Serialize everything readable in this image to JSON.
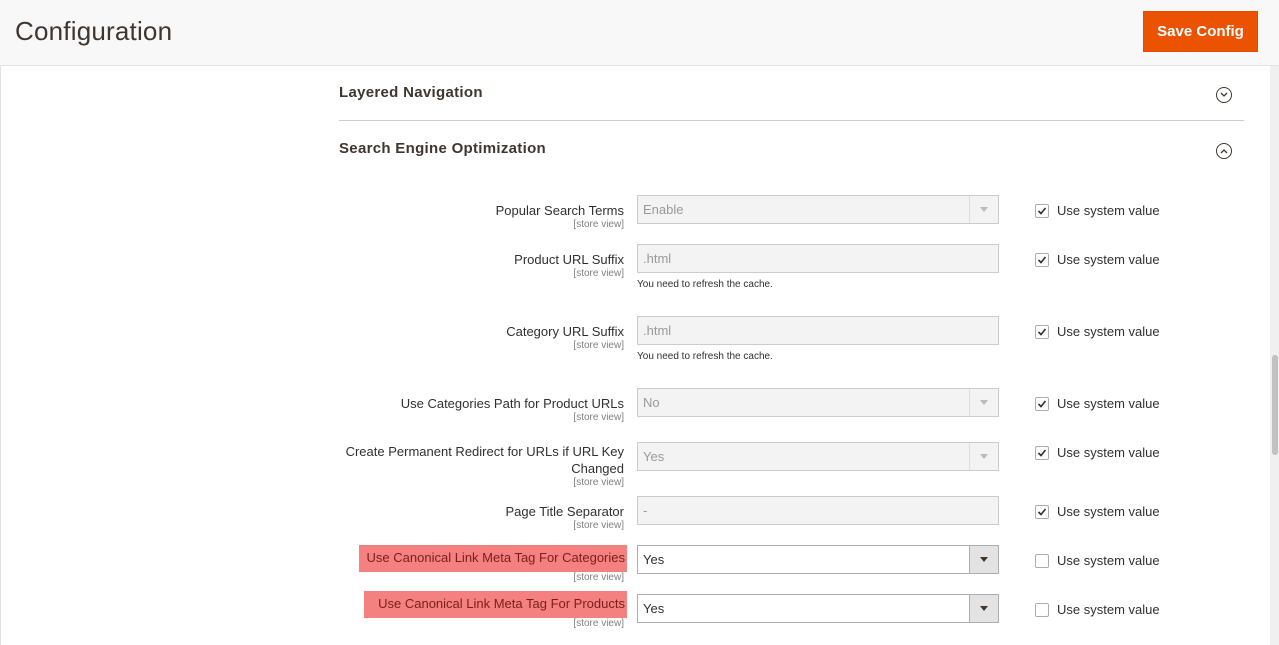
{
  "header": {
    "title": "Configuration",
    "save_label": "Save Config"
  },
  "sections": {
    "layered_navigation": {
      "title": "Layered Navigation",
      "expanded": false
    },
    "seo": {
      "title": "Search Engine Optimization",
      "expanded": true
    }
  },
  "fields": [
    {
      "label": "Popular Search Terms",
      "scope": "[store view]",
      "type": "select",
      "value": "Enable",
      "note": "",
      "use_system_value": true
    },
    {
      "label": "Product URL Suffix",
      "scope": "[store view]",
      "type": "text",
      "value": ".html",
      "note": "You need to refresh the cache.",
      "use_system_value": true
    },
    {
      "label": "Category URL Suffix",
      "scope": "[store view]",
      "type": "text",
      "value": ".html",
      "note": "You need to refresh the cache.",
      "use_system_value": true
    },
    {
      "label": "Use Categories Path for Product URLs",
      "scope": "[store view]",
      "type": "select",
      "value": "No",
      "note": "",
      "use_system_value": true
    },
    {
      "label_line1": "Create Permanent Redirect for URLs if URL Key",
      "label_line2": "Changed",
      "scope": "[store view]",
      "type": "select",
      "value": "Yes",
      "note": "",
      "use_system_value": true
    },
    {
      "label": "Page Title Separator",
      "scope": "[store view]",
      "type": "text",
      "value": "-",
      "note": "",
      "use_system_value": true
    },
    {
      "label": "Use Canonical Link Meta Tag For Categories",
      "scope": "[store view]",
      "type": "select",
      "value": "Yes",
      "note": "",
      "use_system_value": false,
      "highlighted": true
    },
    {
      "label": "Use Canonical Link Meta Tag For Products",
      "scope": "[store view]",
      "type": "select",
      "value": "Yes",
      "note": "",
      "use_system_value": false,
      "highlighted": true
    }
  ],
  "use_system_value_label": "Use system value",
  "colors": {
    "accent": "#eb5202",
    "highlight": "#f58080"
  }
}
